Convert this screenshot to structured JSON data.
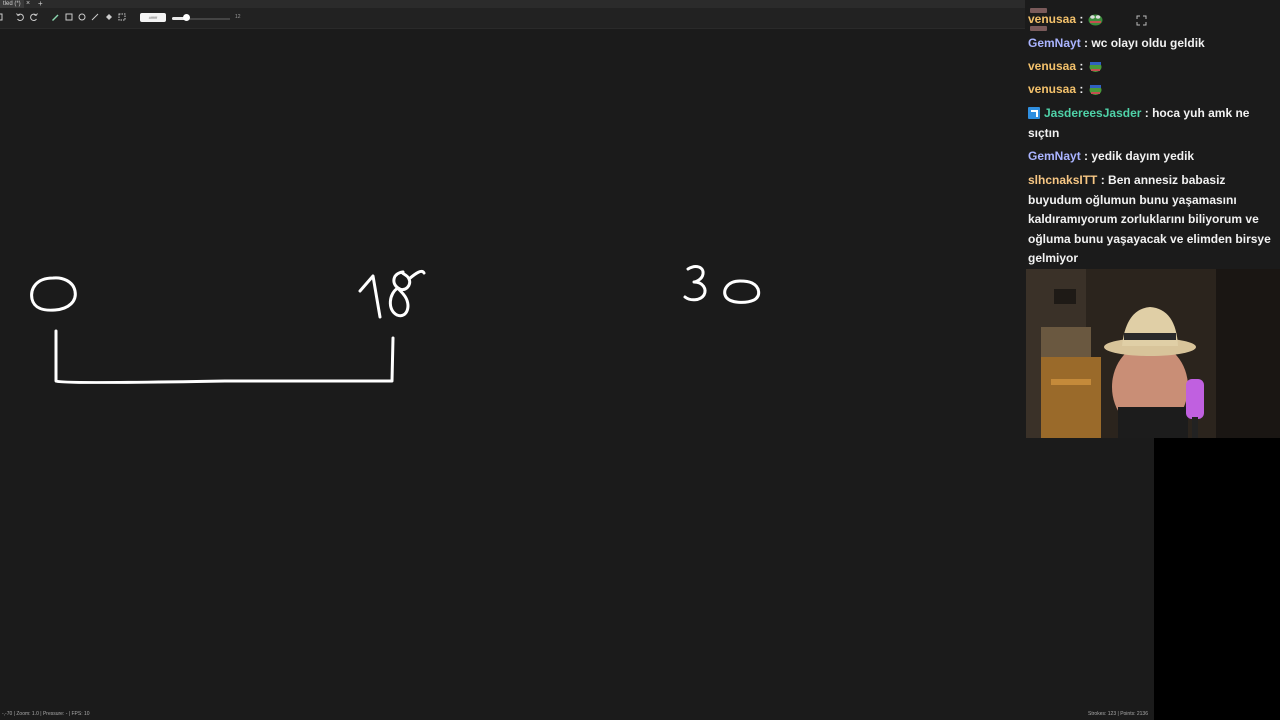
{
  "tab": {
    "title": "tled (*)",
    "close": "×",
    "add": "+"
  },
  "toolbar": {
    "tools": [
      "menu-icon",
      "undo-icon",
      "redo-icon",
      "pen-icon",
      "rectangle-icon",
      "circle-icon",
      "line-icon",
      "fill-icon",
      "select-icon"
    ],
    "swatch_label": "#ffffff",
    "brush_size_label": "12",
    "brush_size_fraction": 0.25
  },
  "canvas": {
    "background": "#1b1b1b",
    "stroke_color": "#ffffff"
  },
  "status": {
    "left": "-,-70 | Zoom: 1.0 | Pressure: - | FPS: 10",
    "right": "Strokes: 123 | Points: 2136"
  },
  "chat": {
    "messages": [
      {
        "user": "venusaa",
        "color": "#f3c16b",
        "text": "",
        "emote": "pepe-icon"
      },
      {
        "user": "GemNayt",
        "color": "#aab4ff",
        "text": "wc olayı oldu geldik"
      },
      {
        "user": "venusaa",
        "color": "#f3c16b",
        "text": "",
        "emote": "pepe-icon"
      },
      {
        "user": "venusaa",
        "color": "#f3c16b",
        "text": "",
        "emote": "pepe-icon"
      },
      {
        "user": "JasdereesJasder",
        "color": "#4fd2a8",
        "text": "hoca yuh amk ne sıçtın",
        "badge": true
      },
      {
        "user": "GemNayt",
        "color": "#aab4ff",
        "text": "yedik dayım yedik"
      },
      {
        "user": "slhcnaksITT",
        "color": "#f7c784",
        "text": "Ben annesiz babasiz buyudum oğlumun bunu yaşamasını kaldıramıyorum zorluklarını biliyorum ve oğluma bunu yaşayacak ve elimden birsye gelmiyor"
      }
    ]
  }
}
